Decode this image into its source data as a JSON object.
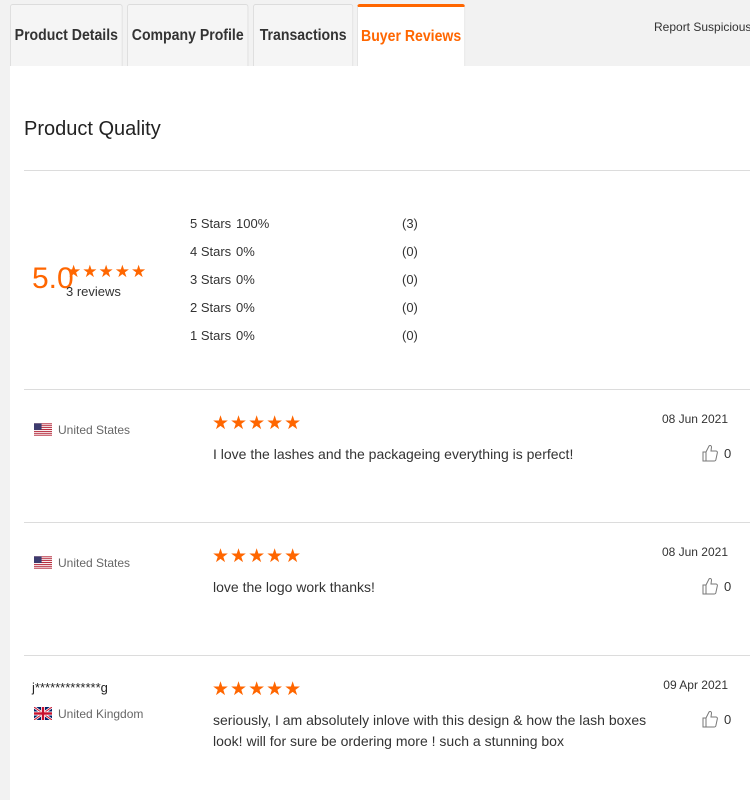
{
  "tabs": [
    {
      "label": "Product Details"
    },
    {
      "label": "Company Profile"
    },
    {
      "label": "Transactions"
    },
    {
      "label": "Buyer Reviews"
    }
  ],
  "report_link": "Report Suspicious Activ",
  "section_title": "Product Quality",
  "summary": {
    "score": "5.0",
    "stars": "★★★★★",
    "rating_value": 5,
    "review_count": "3 reviews",
    "distribution": [
      {
        "label": "5 Stars",
        "percent": "100%",
        "count": "(3)"
      },
      {
        "label": "4 Stars",
        "percent": "0%",
        "count": "(0)"
      },
      {
        "label": "3 Stars",
        "percent": "0%",
        "count": "(0)"
      },
      {
        "label": "2 Stars",
        "percent": "0%",
        "count": "(0)"
      },
      {
        "label": "1 Stars",
        "percent": "0%",
        "count": "(0)"
      }
    ]
  },
  "reviews": [
    {
      "name": "",
      "country": "United States",
      "flag": "us-flag",
      "stars": "★★★★★",
      "rating": 5,
      "date": "08 Jun 2021",
      "text": "I love the lashes and the packageing everything is perfect!",
      "likes": "0"
    },
    {
      "name": "",
      "country": "United States",
      "flag": "us-flag",
      "stars": "★★★★★",
      "rating": 5,
      "date": "08 Jun 2021",
      "text": "love the logo work thanks!",
      "likes": "0"
    },
    {
      "name": "j*************g",
      "country": "United Kingdom",
      "flag": "uk-flag",
      "stars": "★★★★★",
      "rating": 5,
      "date": "09 Apr 2021",
      "text": "seriously, I am absolutely inlove with this design & how the lash boxes look! will for sure be ordering more ! such a stunning box",
      "likes": "0"
    }
  ],
  "colors": {
    "accent": "#ff6600",
    "divider": "#dcdcdc",
    "background": "#f2f2f2"
  }
}
